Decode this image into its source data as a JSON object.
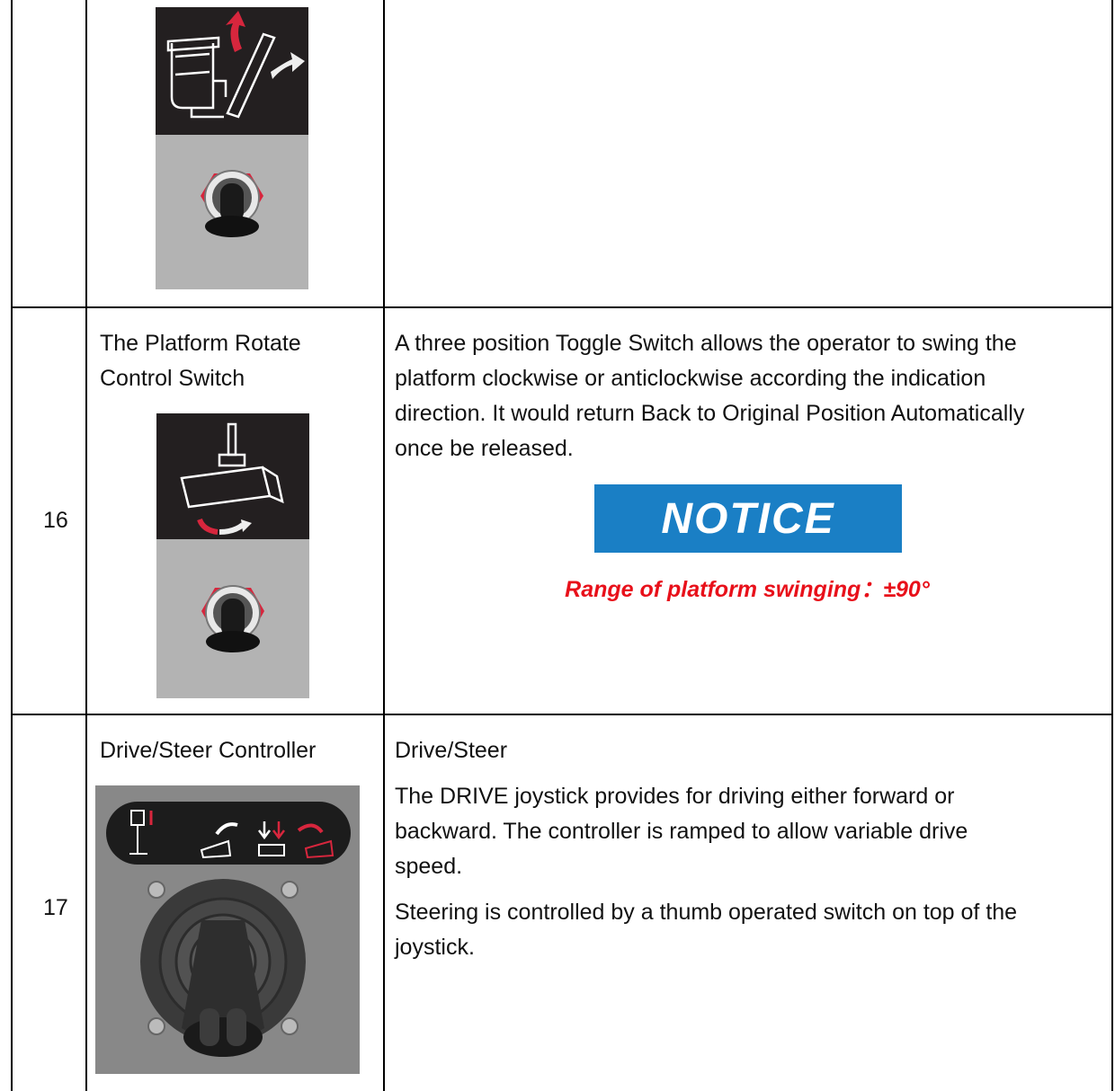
{
  "rows": [
    {
      "number": "",
      "name_lines": [],
      "description_lines": [],
      "icon": "platform-level-toggle-panel"
    },
    {
      "number": "16",
      "name_lines": [
        "The Platform Rotate",
        "Control Switch"
      ],
      "description_lines": [
        "A three position Toggle Switch allows the operator to swing the",
        "platform clockwise or anticlockwise according the indication",
        "direction. It would return Back to Original Position Automatically",
        "once be released."
      ],
      "notice_label": "NOTICE",
      "notice_text": "Range of platform swinging：±90°",
      "icon": "platform-rotate-toggle-panel"
    },
    {
      "number": "17",
      "name_lines": [
        "Drive/Steer Controller"
      ],
      "description_heading": "Drive/Steer",
      "description_lines": [
        "The DRIVE joystick provides for driving either forward or",
        "backward. The controller is ramped to allow variable drive",
        "speed."
      ],
      "description_lines_2": [
        "Steering is controlled by a thumb operated switch on top of the",
        "joystick."
      ],
      "icon": "drive-steer-joystick-panel"
    }
  ],
  "colors": {
    "notice_blue": "#1a7fc5",
    "warning_red": "#e8101a",
    "panel_dark": "#231f20",
    "panel_gray": "#b3b3b3"
  }
}
